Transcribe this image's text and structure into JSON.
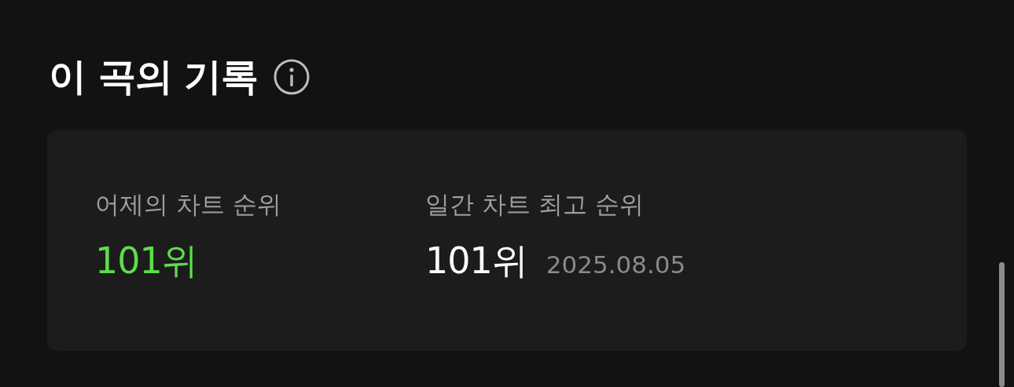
{
  "section": {
    "title": "이 곡의 기록"
  },
  "stats": [
    {
      "label": "어제의 차트 순위",
      "value": "101위",
      "highlighted": true
    },
    {
      "label": "일간 차트 최고 순위",
      "value": "101위",
      "date": "2025.08.05",
      "highlighted": false
    }
  ]
}
